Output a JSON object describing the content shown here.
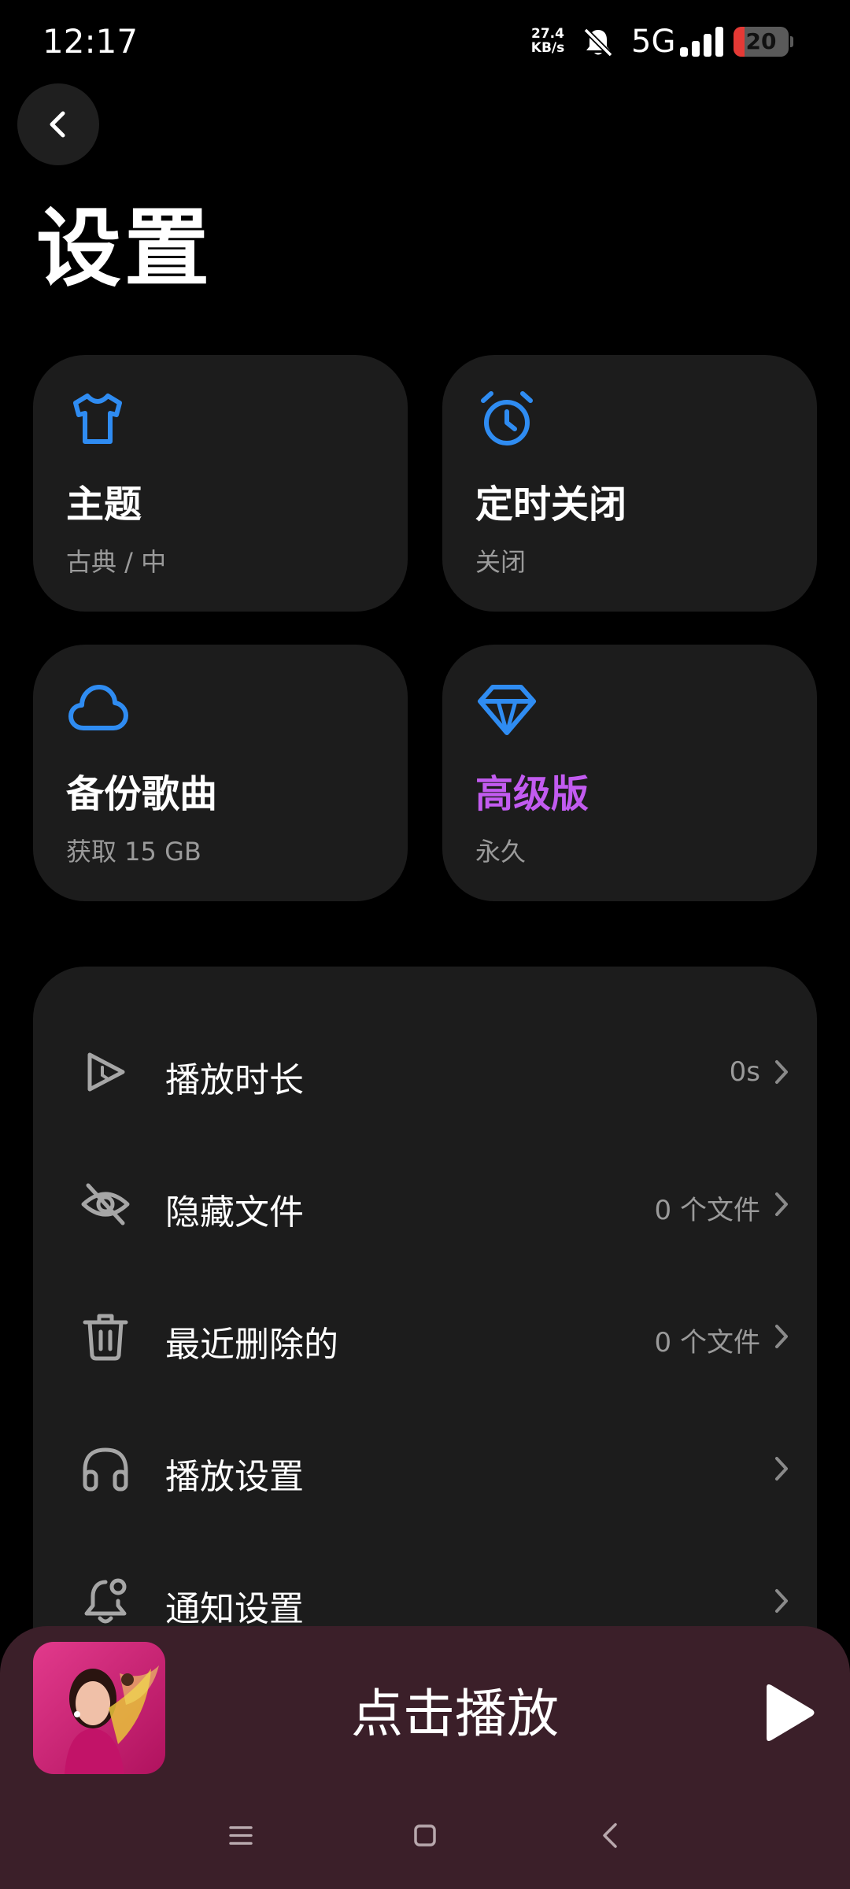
{
  "status_bar": {
    "time": "12:17",
    "net_speed_value": "27.4",
    "net_speed_unit": "KB/s",
    "network": "5G",
    "battery": "20",
    "battery_level": 0.2,
    "icons": [
      "bell-off-icon",
      "signal-icon",
      "battery-icon"
    ]
  },
  "header": {
    "back_icon": "arrow-left-icon",
    "title": "设置"
  },
  "cards": [
    {
      "icon": "tshirt-icon",
      "title": "主题",
      "subtitle": "古典 / 中",
      "title_color": "#ffffff"
    },
    {
      "icon": "alarm-clock-icon",
      "title": "定时关闭",
      "subtitle": "关闭",
      "title_color": "#ffffff"
    },
    {
      "icon": "cloud-icon",
      "title": "备份歌曲",
      "subtitle": "获取 15 GB",
      "title_color": "#ffffff"
    },
    {
      "icon": "diamond-icon",
      "title": "高级版",
      "subtitle": "永久",
      "title_color": "#c25bf0"
    }
  ],
  "settings_list": [
    {
      "icon": "play-duration-icon",
      "label": "播放时长",
      "value": "0s"
    },
    {
      "icon": "eye-off-icon",
      "label": "隐藏文件",
      "value": "0 个文件"
    },
    {
      "icon": "trash-icon",
      "label": "最近删除的",
      "value": "0 个文件"
    },
    {
      "icon": "headphones-icon",
      "label": "播放设置",
      "value": ""
    },
    {
      "icon": "bell-notification-icon",
      "label": "通知设置",
      "value": ""
    }
  ],
  "player": {
    "title": "点击播放",
    "play_icon": "play-icon"
  },
  "nav_bar": {
    "icons": [
      "menu-icon",
      "home-icon",
      "back-icon"
    ]
  },
  "colors": {
    "background": "#000000",
    "card": "#1c1c1c",
    "accent_blue": "#2f8cf2",
    "premium_purple": "#c25bf0",
    "secondary_text": "#9a9a9a",
    "player_bg": "#3b1f29"
  }
}
